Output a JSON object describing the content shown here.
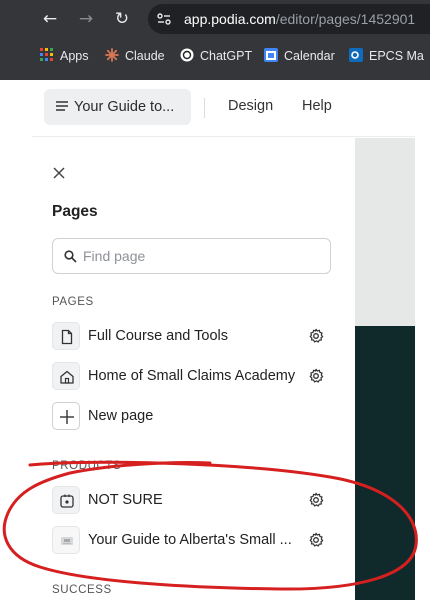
{
  "browser": {
    "url_host": "app.podia.com",
    "url_path": "/editor/pages/1452901",
    "bookmarks": [
      {
        "label": "Apps",
        "icon": "apps-grid-icon"
      },
      {
        "label": "Claude",
        "icon": "claude-icon"
      },
      {
        "label": "ChatGPT",
        "icon": "chatgpt-icon"
      },
      {
        "label": "Calendar",
        "icon": "calendar-icon"
      },
      {
        "label": "EPCS Ma",
        "icon": "outlook-icon"
      }
    ]
  },
  "topbar": {
    "guide_label": "Your Guide to...",
    "design_label": "Design",
    "help_label": "Help"
  },
  "panel": {
    "title": "Pages",
    "search_placeholder": "Find page",
    "sections": {
      "pages": "PAGES",
      "products": "PRODUCTS",
      "success": "SUCCESS"
    },
    "pages": [
      {
        "label": "Full Course and Tools",
        "icon": "file-icon"
      },
      {
        "label": "Home of Small Claims Academy",
        "icon": "home-icon"
      }
    ],
    "new_page_label": "New page",
    "products": [
      {
        "label": "NOT SURE",
        "icon": "product-icon"
      },
      {
        "label": "Your Guide to Alberta's Small ...",
        "icon": "thumbnail-icon"
      }
    ]
  },
  "colors": {
    "chrome_bg": "#35363a",
    "preview_dark": "#10292a",
    "annotation": "#d62020"
  }
}
